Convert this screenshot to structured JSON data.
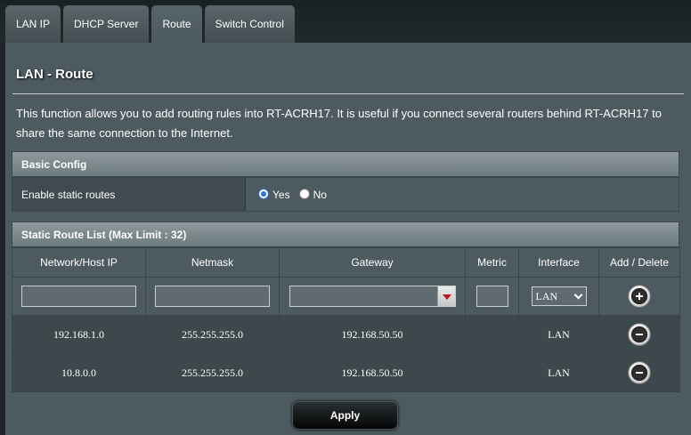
{
  "tabs": [
    {
      "label": "LAN IP",
      "active": false
    },
    {
      "label": "DHCP Server",
      "active": false
    },
    {
      "label": "Route",
      "active": true
    },
    {
      "label": "Switch Control",
      "active": false
    }
  ],
  "page": {
    "title": "LAN - Route",
    "description": "This function allows you to add routing rules into RT-ACRH17. It is useful if you connect several routers behind RT-ACRH17 to share the same connection to the Internet."
  },
  "basic_config": {
    "header": "Basic Config",
    "static_routes_label": "Enable static routes",
    "options": [
      "Yes",
      "No"
    ],
    "selected": "Yes"
  },
  "route_list": {
    "header": "Static Route List (Max Limit : 32)",
    "columns": [
      "Network/Host IP",
      "Netmask",
      "Gateway",
      "Metric",
      "Interface",
      "Add / Delete"
    ],
    "input_row": {
      "network": "",
      "netmask": "",
      "gateway": "",
      "metric": "",
      "interface": "LAN"
    },
    "rows": [
      {
        "network": "192.168.1.0",
        "netmask": "255.255.255.0",
        "gateway": "192.168.50.50",
        "metric": "",
        "interface": "LAN"
      },
      {
        "network": "10.8.0.0",
        "netmask": "255.255.255.0",
        "gateway": "192.168.50.50",
        "metric": "",
        "interface": "LAN"
      }
    ]
  },
  "apply_label": "Apply",
  "icons": {
    "add": "plus-circle-icon",
    "delete": "minus-circle-icon",
    "dropdown": "red-triangle-down-icon"
  }
}
